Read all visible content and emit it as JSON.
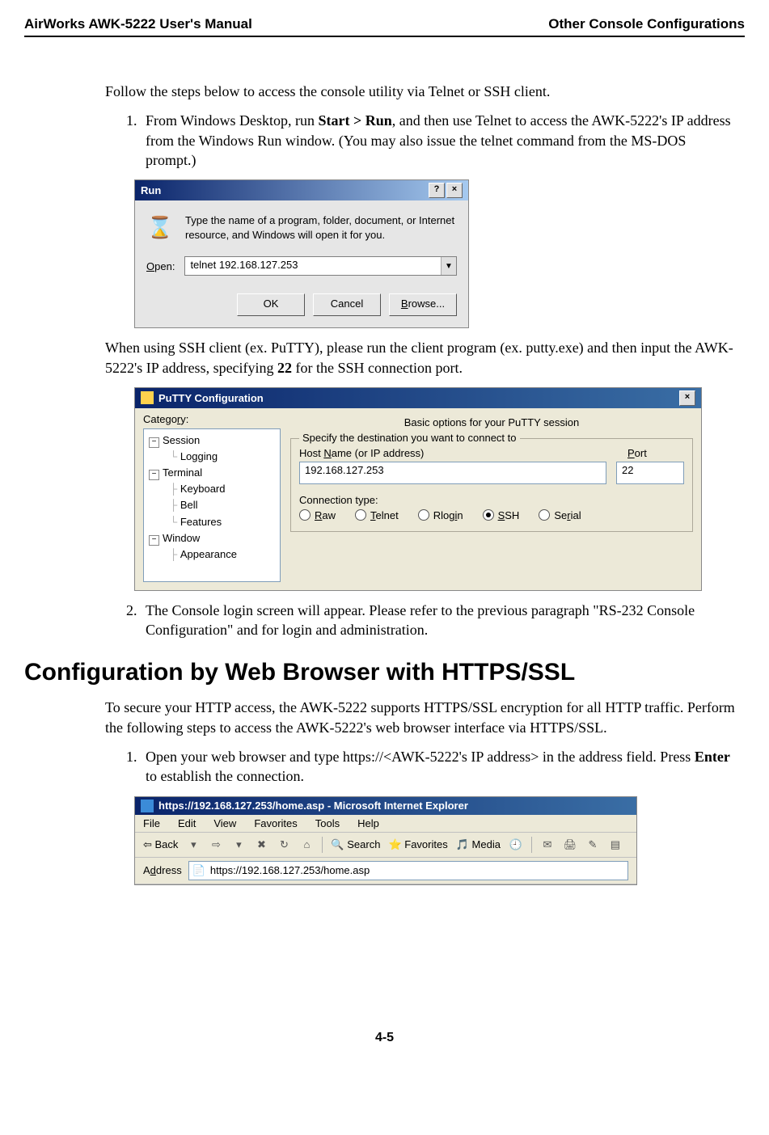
{
  "header": {
    "left": "AirWorks AWK-5222 User's Manual",
    "right": "Other Console Configurations"
  },
  "intro": "Follow the steps below to access the console utility via Telnet or SSH client.",
  "step1_pre": "From Windows Desktop, run ",
  "step1_bold": "Start > Run",
  "step1_post": ", and then use Telnet to access the AWK-5222's IP address from the Windows Run window. (You may also issue the telnet command from the MS-DOS prompt.)",
  "run": {
    "title": "Run",
    "help": "?",
    "close": "×",
    "icon": "⌛",
    "message": "Type the name of a program, folder, document, or Internet resource, and Windows will open it for you.",
    "open_label": "Open:",
    "open_value": "telnet 192.168.127.253",
    "ok": "OK",
    "cancel": "Cancel",
    "browse": "Browse..."
  },
  "ssh_para_pre": "When using SSH client (ex. PuTTY), please run the client program (ex. putty.exe) and then input the AWK-5222's IP address, specifying ",
  "ssh_para_bold": "22",
  "ssh_para_post": " for the SSH connection port.",
  "putty": {
    "title": "PuTTY Configuration",
    "close": "×",
    "category_label": "Category:",
    "tree": {
      "session": "Session",
      "logging": "Logging",
      "terminal": "Terminal",
      "keyboard": "Keyboard",
      "bell": "Bell",
      "features": "Features",
      "window": "Window",
      "appearance": "Appearance"
    },
    "banner": "Basic options for your PuTTY session",
    "group_title": "Specify the destination you want to connect to",
    "host_label": "Host Name (or IP address)",
    "port_label": "Port",
    "host_value": "192.168.127.253",
    "port_value": "22",
    "conntype_label": "Connection type:",
    "radios": {
      "raw": "Raw",
      "telnet": "Telnet",
      "rlogin": "Rlogin",
      "ssh": "SSH",
      "serial": "Serial"
    }
  },
  "step2": "The Console login screen will appear. Please refer to the previous paragraph \"RS-232 Console Configuration\" and for login and administration.",
  "section_heading": "Configuration by Web Browser with HTTPS/SSL",
  "https_para": "To secure your HTTP access, the AWK-5222 supports HTTPS/SSL encryption for all HTTP traffic. Perform the following steps to access the AWK-5222's web browser interface via HTTPS/SSL.",
  "https_step1_pre": "Open your web browser and type https://<AWK-5222's IP address> in the address field. Press ",
  "https_step1_bold": "Enter",
  "https_step1_post": " to establish the connection.",
  "ie": {
    "title": "https://192.168.127.253/home.asp - Microsoft Internet Explorer",
    "menu": [
      "File",
      "Edit",
      "View",
      "Favorites",
      "Tools",
      "Help"
    ],
    "back": "Back",
    "search": "Search",
    "favorites": "Favorites",
    "media": "Media",
    "addr_label": "Address",
    "addr_value": "https://192.168.127.253/home.asp"
  },
  "page_number": "4-5"
}
